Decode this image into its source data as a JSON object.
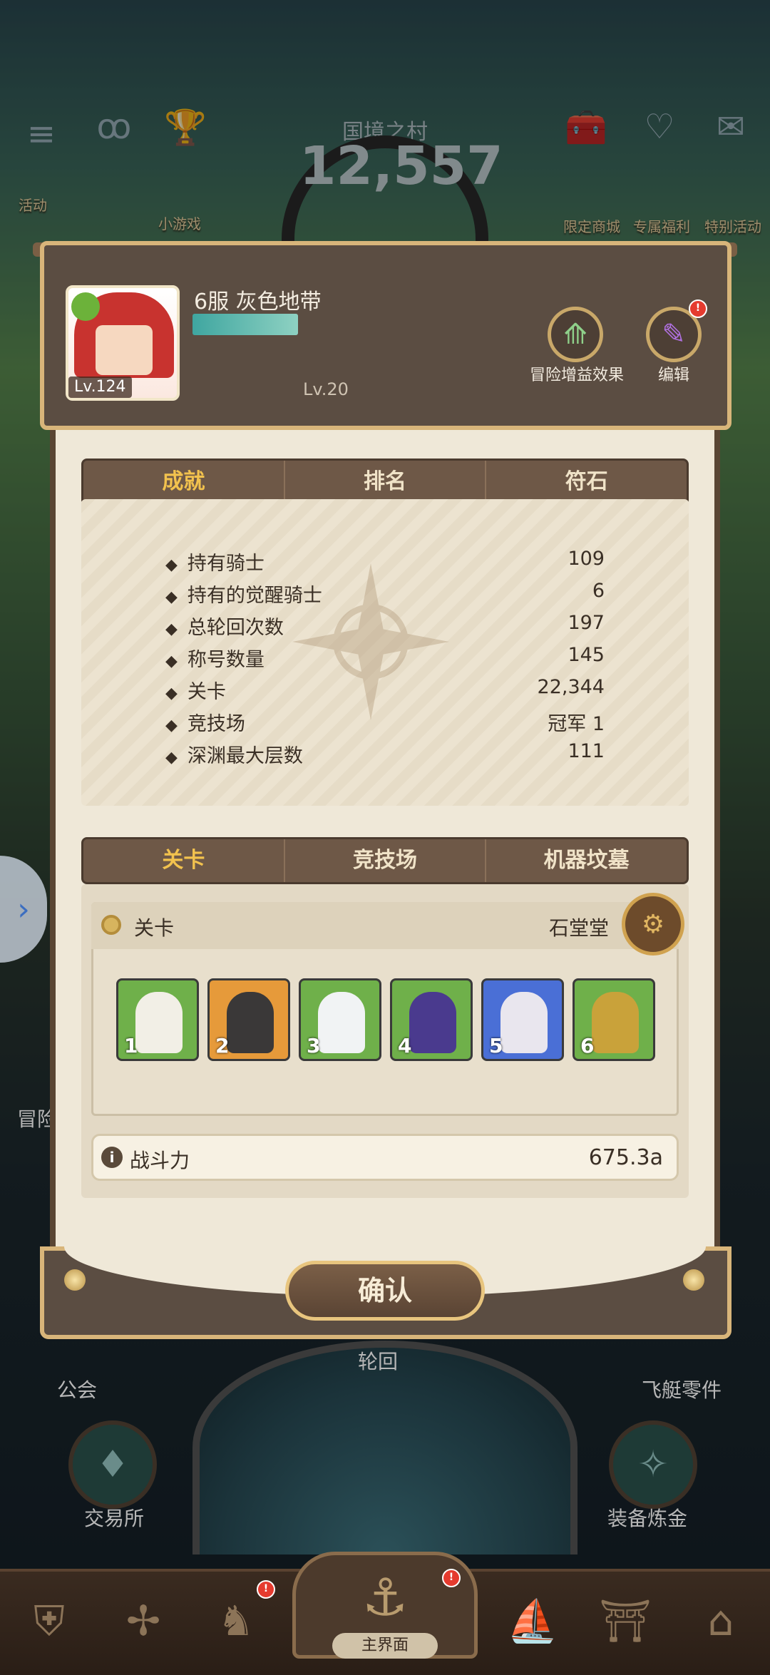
{
  "hud": {
    "region_title": "国境之村",
    "score": "12,557",
    "left_labels": [
      "活动",
      "小游戏"
    ],
    "right_labels": [
      "限定商城",
      "专属福利",
      "特别活动"
    ]
  },
  "profile": {
    "avatar_level": "Lv.124",
    "name": "6服 灰色地带",
    "guild_level": "Lv.20",
    "buff_label": "冒险增益效果",
    "edit_label": "编辑",
    "edit_badge": "!"
  },
  "info_tabs": {
    "items": [
      "成就",
      "排名",
      "符石"
    ],
    "active": 0
  },
  "stats": [
    {
      "label": "持有骑士",
      "value": "109"
    },
    {
      "label": "持有的觉醒骑士",
      "value": "6"
    },
    {
      "label": "总轮回次数",
      "value": "197"
    },
    {
      "label": "称号数量",
      "value": "145"
    },
    {
      "label": "关卡",
      "value": "22,344"
    },
    {
      "label": "竞技场",
      "value": "冠军 1"
    },
    {
      "label": "深渊最大层数",
      "value": "111"
    }
  ],
  "team_tabs": {
    "items": [
      "关卡",
      "竞技场",
      "机器坟墓"
    ],
    "active": 0
  },
  "stage": {
    "label": "关卡",
    "location": "石堂堂",
    "heroes": [
      {
        "slot": "1",
        "bg": "#6fb04a",
        "color": "#f2efe6"
      },
      {
        "slot": "2",
        "bg": "#e69a3a",
        "color": "#3a3838"
      },
      {
        "slot": "3",
        "bg": "#6fb04a",
        "color": "#f1f3f4"
      },
      {
        "slot": "4",
        "bg": "#6fb04a",
        "color": "#4a3a8e"
      },
      {
        "slot": "5",
        "bg": "#4a6fd6",
        "color": "#e9e6ee"
      },
      {
        "slot": "6",
        "bg": "#6fb04a",
        "color": "#c9a23a"
      }
    ]
  },
  "power": {
    "label": "战斗力",
    "value": "675.3a"
  },
  "confirm_label": "确认",
  "background": {
    "labels": [
      "冒险",
      "公会",
      "轮回",
      "飞艇零件",
      "交易所",
      "装备炼金"
    ]
  },
  "nav": {
    "home_label": "主界面"
  },
  "colors": {
    "accent": "#f2c24e",
    "panel": "#efe8d8",
    "frame": "#5b4d42",
    "gold_border": "#d8b57a"
  }
}
